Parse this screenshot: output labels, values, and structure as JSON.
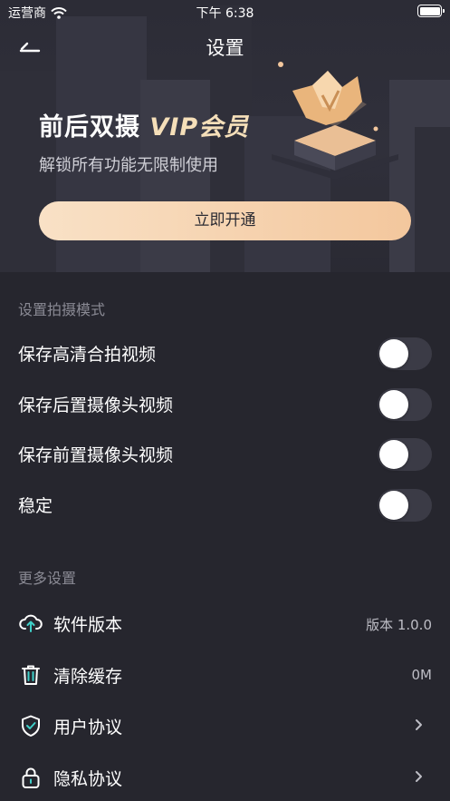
{
  "status_bar": {
    "carrier": "运营商",
    "time": "下午 6:38"
  },
  "nav": {
    "title": "设置",
    "back_icon": "back-arrow-icon"
  },
  "promo": {
    "title_main": "前后双摄",
    "title_vip": "VIP会员",
    "subtitle": "解锁所有功能无限制使用",
    "button_label": "立即开通",
    "accent_color": "#f3c79d"
  },
  "shooting_section": {
    "header": "设置拍摄模式",
    "toggles": [
      {
        "label": "保存高清合拍视频",
        "on": false
      },
      {
        "label": "保存后置摄像头视频",
        "on": false
      },
      {
        "label": "保存前置摄像头视频",
        "on": false
      },
      {
        "label": "稳定",
        "on": false
      }
    ]
  },
  "more_section": {
    "header": "更多设置",
    "items": [
      {
        "label": "软件版本",
        "value": "版本 1.0.0",
        "icon": "cloud-upload-icon"
      },
      {
        "label": "清除缓存",
        "value": "0M",
        "icon": "trash-icon"
      },
      {
        "label": "用户协议",
        "value": "",
        "icon": "shield-check-icon"
      },
      {
        "label": "隐私协议",
        "value": "",
        "icon": "lock-icon"
      }
    ]
  }
}
